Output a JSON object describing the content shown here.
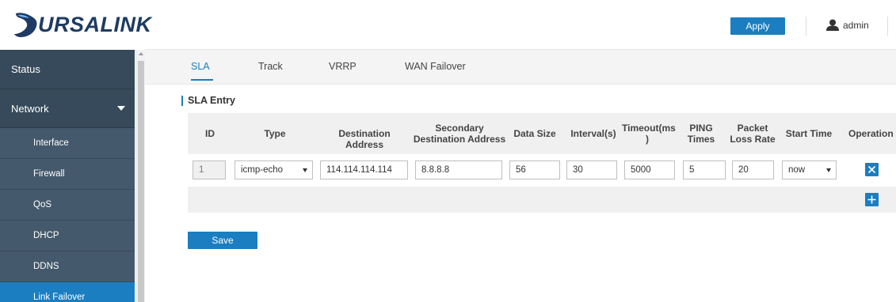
{
  "header": {
    "brand": "URSALINK",
    "apply_label": "Apply",
    "user_label": "admin"
  },
  "sidebar": {
    "items": [
      {
        "label": "Status"
      },
      {
        "label": "Network"
      },
      {
        "label": "Interface"
      },
      {
        "label": "Firewall"
      },
      {
        "label": "QoS"
      },
      {
        "label": "DHCP"
      },
      {
        "label": "DDNS"
      },
      {
        "label": "Link Failover"
      }
    ]
  },
  "tabs": [
    {
      "label": "SLA"
    },
    {
      "label": "Track"
    },
    {
      "label": "VRRP"
    },
    {
      "label": "WAN Failover"
    }
  ],
  "section": {
    "title": "SLA Entry"
  },
  "table": {
    "headers": {
      "id": "ID",
      "type": "Type",
      "dest": "Destination Address",
      "sec1": "Secondary",
      "sec2": "Destination Address",
      "size": "Data Size",
      "interval": "Interval(s)",
      "timeout1": "Timeout(ms",
      "timeout2": ")",
      "ping1": "PING",
      "ping2": "Times",
      "loss1": "Packet",
      "loss2": "Loss Rate",
      "start": "Start Time",
      "operation": "Operation"
    },
    "row": {
      "id": "1",
      "type": "icmp-echo",
      "dest": "114.114.114.114",
      "secondary": "8.8.8.8",
      "size": "56",
      "interval": "30",
      "timeout": "5000",
      "ping": "5",
      "loss": "20",
      "start": "now"
    }
  },
  "save_label": "Save",
  "icons": {
    "delete": "close-icon",
    "add": "plus-icon",
    "user": "user-icon"
  },
  "colors": {
    "accent": "#1a7ec1",
    "sidebar": "#364a5b",
    "sidebar_sub": "#44596b",
    "brand": "#1f3b63"
  }
}
